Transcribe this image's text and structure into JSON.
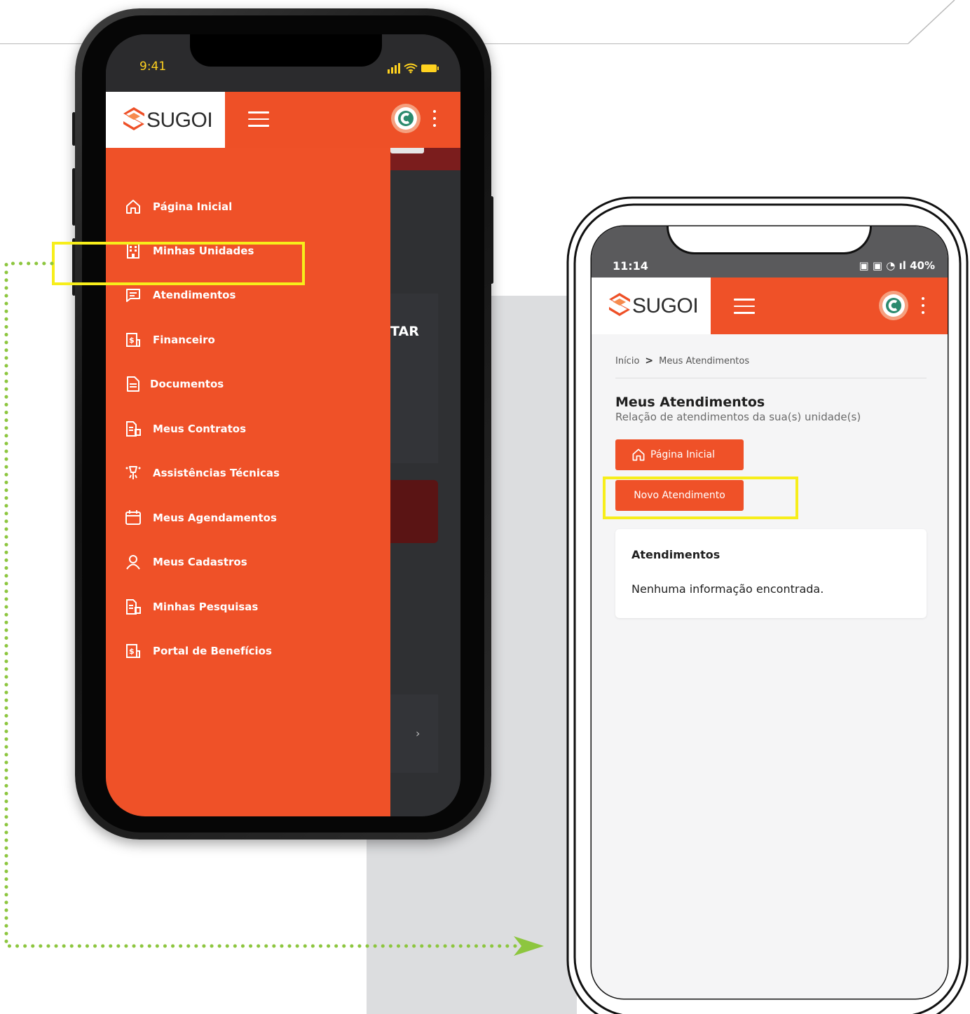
{
  "left_phone": {
    "status_time": "9:41",
    "logo_text": "SUGOI",
    "menu": [
      {
        "label": "Página Inicial",
        "icon": "home-icon"
      },
      {
        "label": "Minhas Unidades",
        "icon": "building-icon"
      },
      {
        "label": "Atendimentos",
        "icon": "message-icon"
      },
      {
        "label": "Financeiro",
        "icon": "finance-icon"
      },
      {
        "label": "Documentos",
        "icon": "document-icon"
      },
      {
        "label": "Meus Contratos",
        "icon": "contract-icon"
      },
      {
        "label": "Assistências Técnicas",
        "icon": "technical-assistance-icon"
      },
      {
        "label": "Meus Agendamentos",
        "icon": "calendar-icon"
      },
      {
        "label": "Meus Cadastros",
        "icon": "user-icon"
      },
      {
        "label": "Minhas Pesquisas",
        "icon": "survey-icon"
      },
      {
        "label": "Portal de Benefícios",
        "icon": "benefits-icon"
      }
    ],
    "background_partial_text": "TAR",
    "background_chevron": "›"
  },
  "right_phone": {
    "status_time": "11:14",
    "status_right": "40%",
    "logo_text": "SUGOI",
    "breadcrumb": {
      "home": "Início",
      "separator": ">",
      "current": "Meus Atendimentos"
    },
    "title": "Meus Atendimentos",
    "subtitle": "Relação de atendimentos da sua(s) unidade(s)",
    "home_button": "Página Inicial",
    "new_button": "Novo Atendimento",
    "card": {
      "title": "Atendimentos",
      "empty_text": "Nenhuma informação encontrada."
    }
  },
  "colors": {
    "brand_orange": "#ef5128",
    "highlight_yellow": "#f7ee1b",
    "connector_green": "#8dc63f",
    "status_time_yellow": "#ffd21f"
  }
}
